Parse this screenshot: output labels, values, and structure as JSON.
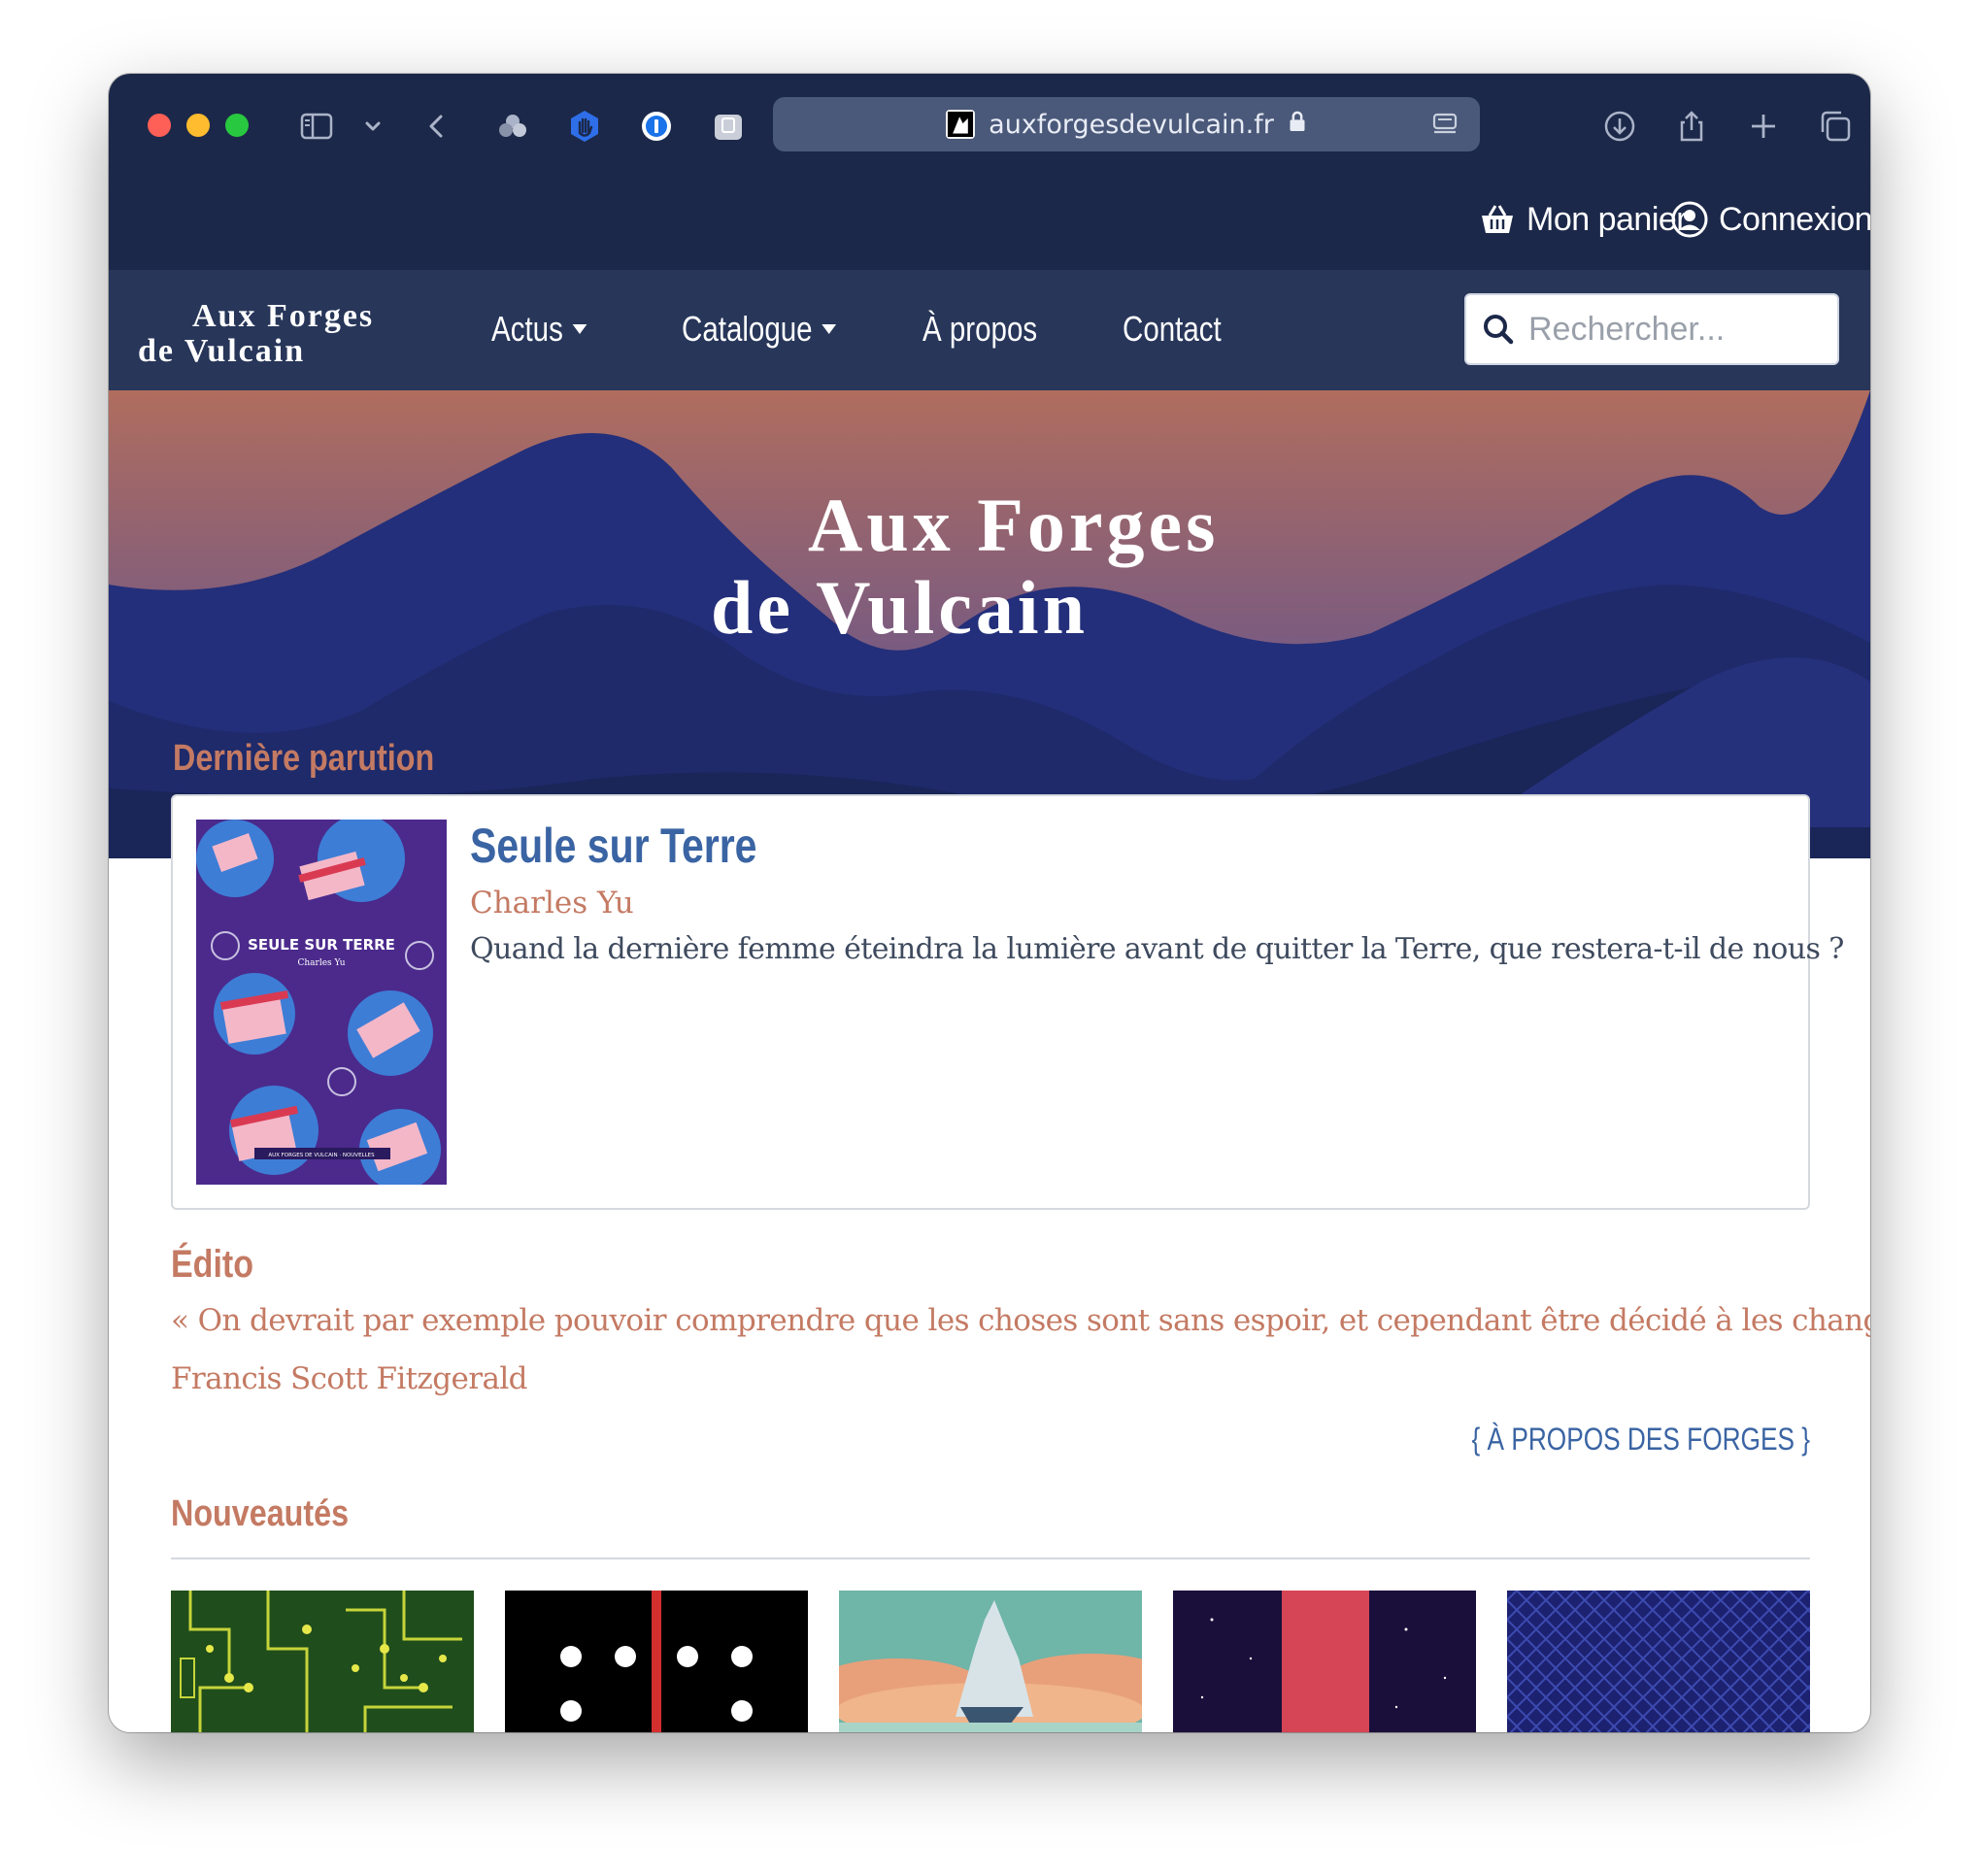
{
  "browser": {
    "url": "auxforgesdevulcain.fr",
    "icons": [
      "sidebar-icon",
      "chevron-down-icon",
      "back-icon",
      "extensions-icon",
      "hand-blocker-icon",
      "password-icon",
      "clipboard-icon",
      "lock-icon",
      "reader-icon",
      "download-icon",
      "share-icon",
      "new-tab-icon",
      "tabs-overview-icon"
    ]
  },
  "topbar": {
    "cart_label": "Mon panier",
    "login_label": "Connexion"
  },
  "nav": {
    "logo_line1": "Aux Forges",
    "logo_line2": "de Vulcain",
    "items": [
      {
        "label": "Actus",
        "has_dropdown": true
      },
      {
        "label": "Catalogue",
        "has_dropdown": true
      },
      {
        "label": "À propos",
        "has_dropdown": false
      },
      {
        "label": "Contact",
        "has_dropdown": false
      }
    ],
    "search_placeholder": "Rechercher..."
  },
  "hero": {
    "logo_line1": "Aux Forges",
    "logo_line2": "de Vulcain"
  },
  "latest": {
    "heading": "Dernière parution",
    "book": {
      "title": "Seule sur Terre",
      "author": "Charles Yu",
      "description": "Quand la dernière femme éteindra la lumière avant de quitter la Terre, que restera-t-il de nous ?",
      "cover_title": "SEULE SUR TERRE",
      "cover_author": "Charles Yu",
      "cover_footer": "AUX FORGES DE VULCAIN · NOUVELLES"
    }
  },
  "edito": {
    "heading": "Édito",
    "quote": "« On devrait par exemple pouvoir comprendre que les choses sont sans espoir, et cependant être décidé à les changer. »",
    "attribution": "Francis Scott Fitzgerald",
    "link_label": "{ À PROPOS DES FORGES }"
  },
  "new_releases": {
    "heading": "Nouveautés",
    "covers": [
      "circuit-board-cover",
      "black-dots-cover",
      "floating-castle-cover",
      "night-sky-red-band-cover",
      "blue-pattern-cover"
    ]
  },
  "colors": {
    "chrome_bg": "#1c2849",
    "nav_bg": "#273659",
    "accent_terracotta": "#c47a63",
    "accent_blue": "#3a64a3",
    "hero_sky_top": "#b06d5e",
    "hero_mountains": "#1f2a6e"
  }
}
